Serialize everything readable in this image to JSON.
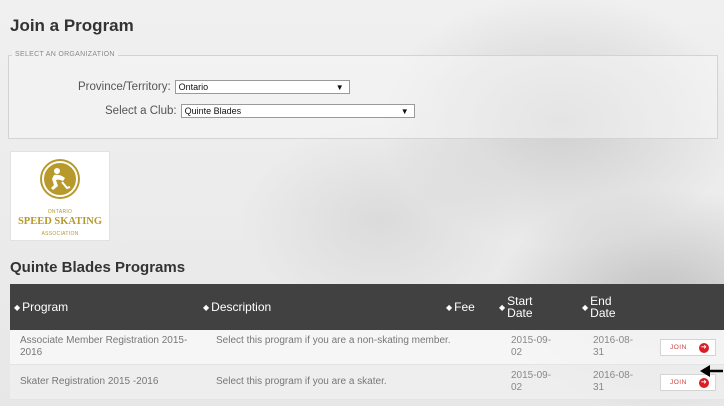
{
  "page": {
    "title": "Join a Program"
  },
  "organization": {
    "legend": "SELECT AN ORGANIZATION",
    "province_label": "Province/Territory:",
    "province_value": "Ontario",
    "club_label": "Select a Club:",
    "club_value": "Quinte Blades"
  },
  "logo": {
    "line_top": "ONTARIO",
    "line_main": "SPEED SKATING",
    "line_bottom": "ASSOCIATION",
    "color": "#b7992c"
  },
  "programs": {
    "title": "Quinte Blades Programs",
    "columns": {
      "program": "Program",
      "description": "Description",
      "fee": "Fee",
      "start_line1": "Start",
      "start_line2": "Date",
      "end_line1": "End",
      "end_line2": "Date"
    },
    "rows": [
      {
        "program": "Associate Member Registration 2015-2016",
        "description": "Select this program if you are a non-skating member.",
        "fee": "",
        "start": "2015-09-02",
        "end": "2016-08-31",
        "join_label": "JOIN"
      },
      {
        "program": "Skater Registration 2015 -2016",
        "description": "Select this program if you are a skater.",
        "fee": "",
        "start": "2015-09-02",
        "end": "2016-08-31",
        "join_label": "JOIN"
      }
    ]
  },
  "colors": {
    "header_bg": "#414141",
    "join_icon": "#d81f26"
  }
}
